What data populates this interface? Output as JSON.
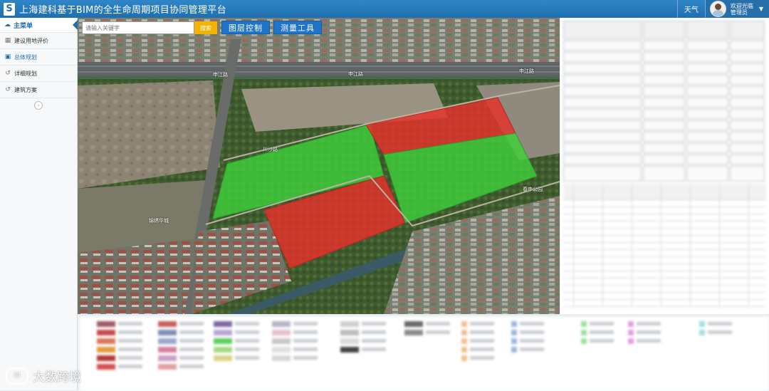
{
  "header": {
    "logo_text": "S",
    "title": "上海建科基于BIM的全生命周期项目协同管理平台",
    "weather_label": "天气",
    "user_greeting": "欢迎光临",
    "user_role": "管理员",
    "dropdown_icon": "caret-down-icon"
  },
  "sidebar": {
    "header_label": "主菜单",
    "items": [
      {
        "label": "建设用地评价",
        "icon": "building-icon",
        "active": false
      },
      {
        "label": "总体规划",
        "icon": "grid-icon",
        "active": true
      },
      {
        "label": "详细规划",
        "icon": "history-icon",
        "active": false
      },
      {
        "label": "建筑方案",
        "icon": "history-icon",
        "active": false
      }
    ],
    "collapse_icon": "chevron-left-icon"
  },
  "map": {
    "search_placeholder": "请输入关键字",
    "search_button": "搜索",
    "layer_control_button": "图层控制",
    "measure_tool_button": "测量工具",
    "parcel_colors": {
      "green": "#3fcf3a",
      "red": "#e8312a"
    },
    "road_labels": [
      "申江路",
      "申江路",
      "川沙路",
      "申江路"
    ],
    "place_labels": [
      "春申公园",
      "锦绣华城"
    ]
  },
  "watermark": {
    "text": "大数跨境"
  },
  "colors": {
    "header_blue": "#1f6fb0",
    "accent_yellow": "#f2b400",
    "button_blue": "#1f73c9"
  }
}
